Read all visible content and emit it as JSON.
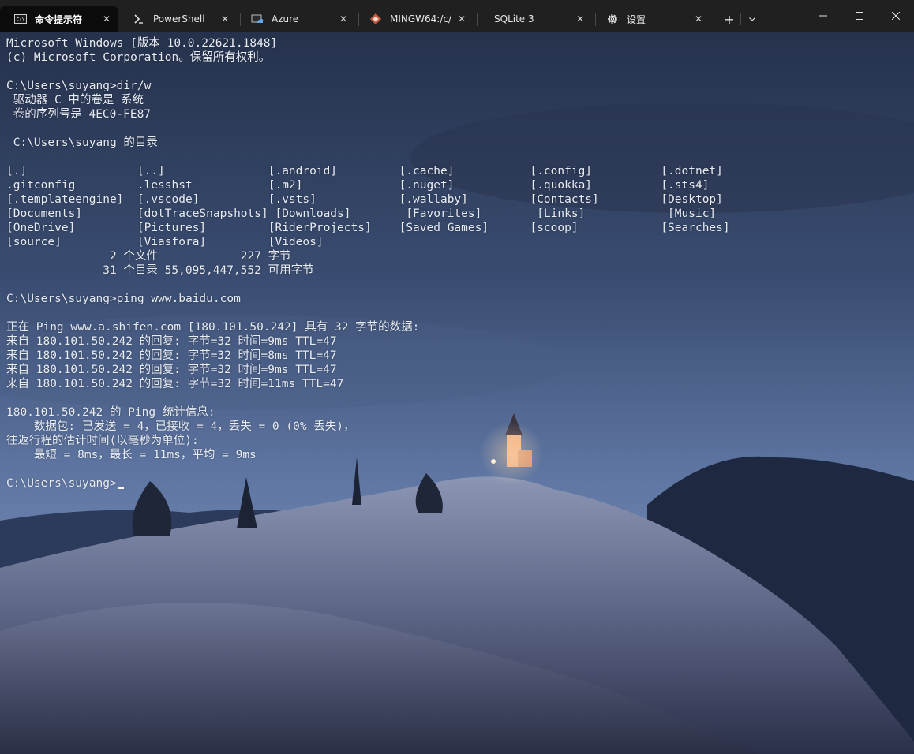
{
  "tabs": [
    {
      "label": "命令提示符",
      "icon": "cmd-icon",
      "active": true
    },
    {
      "label": "PowerShell",
      "icon": "powershell-icon",
      "active": false
    },
    {
      "label": "Azure",
      "icon": "azure-cloud-shell-icon",
      "active": false
    },
    {
      "label": "MINGW64:/c/",
      "icon": "git-bash-icon",
      "active": false
    },
    {
      "label": "SQLite 3",
      "icon": "",
      "active": false
    },
    {
      "label": "设置",
      "icon": "gear-icon",
      "active": false
    }
  ],
  "new_tab_symbol": "+",
  "window_controls": {
    "minimize": "minimize-icon",
    "maximize": "maximize-icon",
    "close": "close-icon"
  },
  "terminal": {
    "lines": [
      "Microsoft Windows [版本 10.0.22621.1848]",
      "(c) Microsoft Corporation。保留所有权利。",
      "",
      "C:\\Users\\suyang>dir/w",
      " 驱动器 C 中的卷是 系统",
      " 卷的序列号是 4EC0-FE87",
      "",
      " C:\\Users\\suyang 的目录",
      "",
      "[.]                [..]               [.android]         [.cache]           [.config]          [.dotnet]",
      ".gitconfig         .lesshst           [.m2]              [.nuget]           [.quokka]          [.sts4]",
      "[.templateengine]  [.vscode]          [.vsts]            [.wallaby]         [Contacts]         [Desktop]",
      "[Documents]        [dotTraceSnapshots] [Downloads]        [Favorites]        [Links]            [Music]",
      "[OneDrive]         [Pictures]         [RiderProjects]    [Saved Games]      [scoop]            [Searches]",
      "[source]           [Viasfora]         [Videos]",
      "               2 个文件            227 字节",
      "              31 个目录 55,095,447,552 可用字节",
      "",
      "C:\\Users\\suyang>ping www.baidu.com",
      "",
      "正在 Ping www.a.shifen.com [180.101.50.242] 具有 32 字节的数据:",
      "来自 180.101.50.242 的回复: 字节=32 时间=9ms TTL=47",
      "来自 180.101.50.242 的回复: 字节=32 时间=8ms TTL=47",
      "来自 180.101.50.242 的回复: 字节=32 时间=9ms TTL=47",
      "来自 180.101.50.242 的回复: 字节=32 时间=11ms TTL=47",
      "",
      "180.101.50.242 的 Ping 统计信息:",
      "    数据包: 已发送 = 4，已接收 = 4，丢失 = 0 (0% 丢失)，",
      "往返行程的估计时间(以毫秒为单位):",
      "    最短 = 8ms，最长 = 11ms，平均 = 9ms",
      "",
      "C:\\Users\\suyang>"
    ]
  },
  "colors": {
    "titlebar": "#202020",
    "active_tab": "#0c0c0c",
    "terminal_text": "#e8ecf4",
    "cursor": "#ffffff"
  }
}
